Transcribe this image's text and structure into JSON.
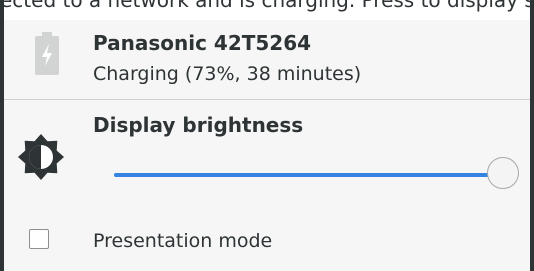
{
  "header_strip": {
    "text": "ected to a network and is charging. Press to display se"
  },
  "battery": {
    "icon": "battery-charging-icon",
    "device_name": "Panasonic 42T5264",
    "status": "Charging (73%, 38 minutes)"
  },
  "brightness": {
    "icon": "brightness-contrast-icon",
    "label": "Display brightness",
    "level_percent": 100
  },
  "presentation_mode": {
    "label": "Presentation mode",
    "checked": false
  },
  "colors": {
    "accent": "#3584e4",
    "background": "#f6f6f6",
    "text": "#2e3436"
  }
}
